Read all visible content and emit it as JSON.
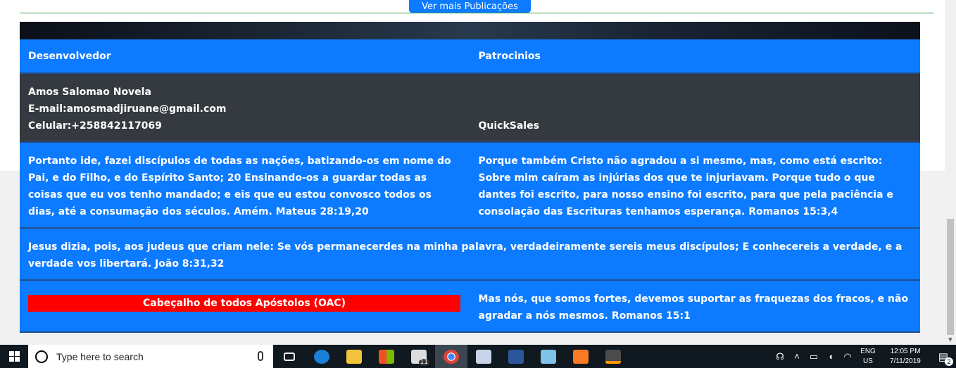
{
  "top_button": {
    "label": "Ver mais Publicações"
  },
  "footer": {
    "headers": {
      "left": "Desenvolvedor",
      "right": "Patrocinios"
    },
    "developer": {
      "name": "Amos Salomao Novela",
      "email": "E-mail:amosmadjiruane@gmail.com",
      "phone": "Celular:+258842117069"
    },
    "sponsor": "QuickSales",
    "verse_left": "Portanto ide, fazei discípulos de todas as nações, batizando-os em nome do Pai, e do Filho, e do Espírito Santo; 20 Ensinando-os a guardar todas as coisas que eu vos tenho mandado; e eis que eu estou convosco todos os dias, até a consumação dos séculos. Amém. Mateus 28:19,20",
    "verse_right": "Porque também Cristo não agradou a si mesmo, mas, como está escrito: Sobre mim caíram as injúrias dos que te injuriavam. Porque tudo o que dantes foi escrito, para nosso ensino foi escrito, para que pela paciência e consolação das Escrituras tenhamos esperança. Romanos 15:3,4",
    "verse_full": "Jesus dizia, pois, aos judeus que criam nele: Se vós permanecerdes na minha palavra, verdadeiramente sereis meus discípulos; E conhecereis a verdade, e a verdade vos libertará. João 8:31,32",
    "red_label": "Cabeçalho de todos Apóstolos (OAC)",
    "verse_last": "Mas nós, que somos fortes, devemos suportar as fraquezas dos fracos, e não agradar a nós mesmos. Romanos 15:1"
  },
  "taskbar": {
    "search_placeholder": "Type here to search",
    "mail_badge": "11",
    "lang_top": "ENG",
    "lang_bottom": "US",
    "time": "12:05 PM",
    "date": "7/11/2019",
    "notification_count": "2"
  },
  "colors": {
    "blue": "#0d7bff",
    "dark": "#343a40",
    "red": "#ff0000"
  }
}
